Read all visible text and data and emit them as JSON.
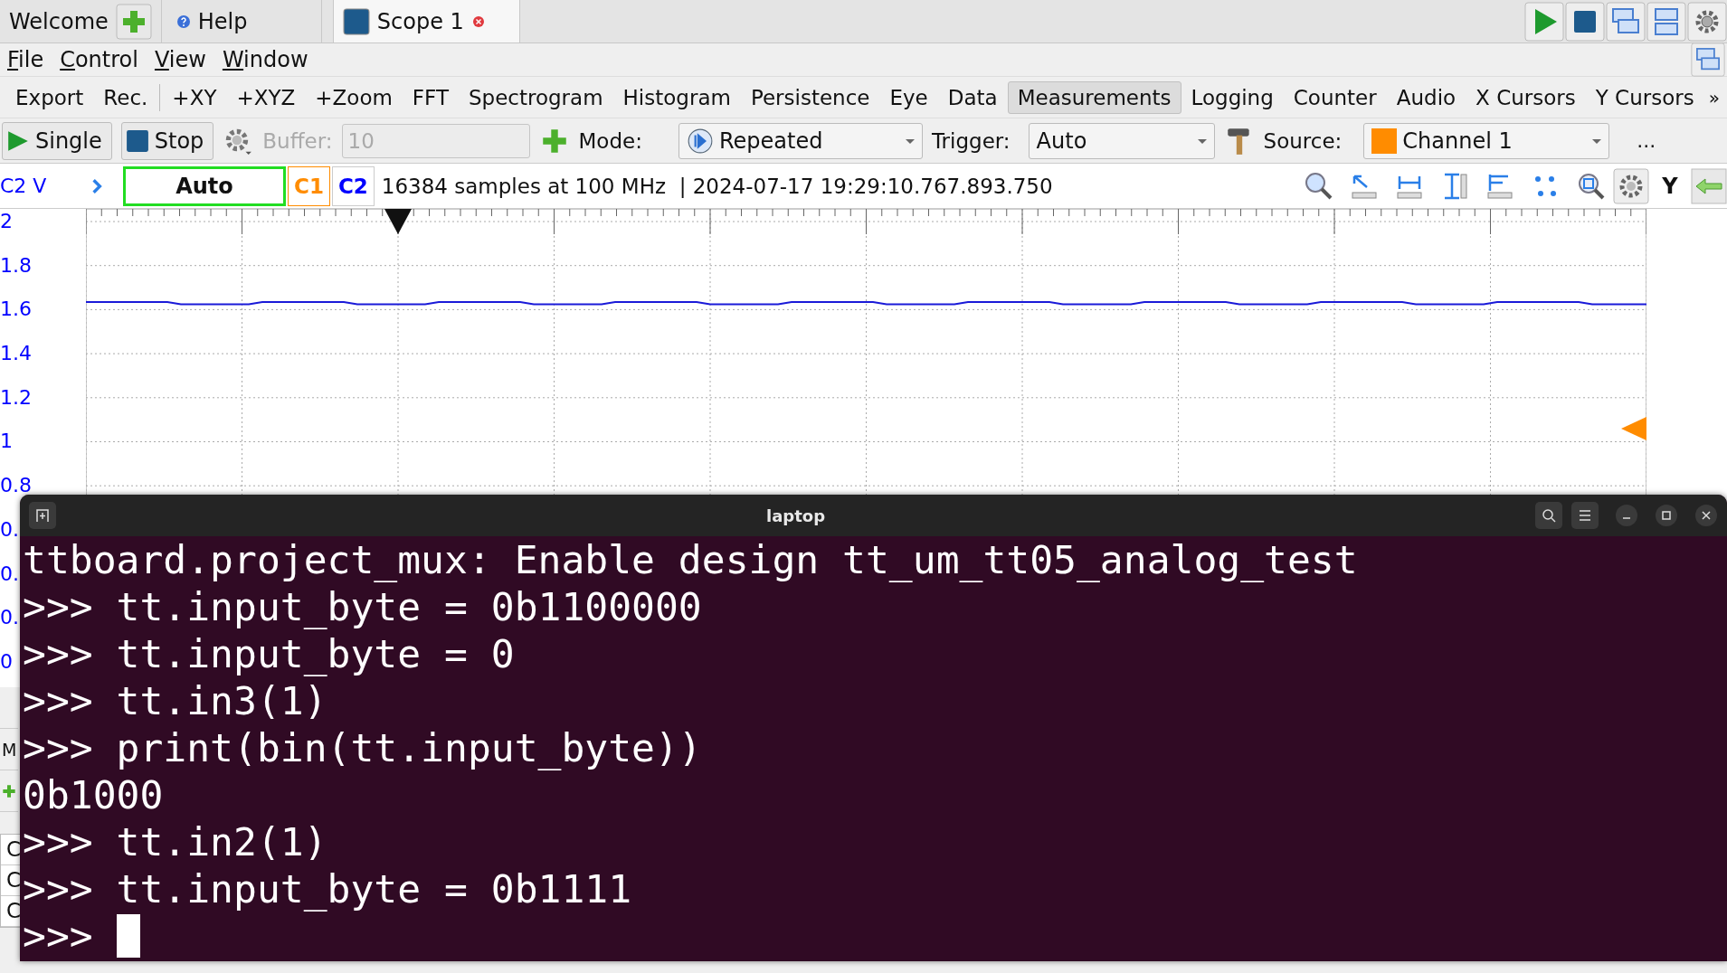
{
  "tabs": [
    {
      "label": "Welcome",
      "selected": false,
      "kind": "add"
    },
    {
      "label": "Help",
      "selected": false,
      "kind": "help"
    },
    {
      "label": "Scope 1",
      "selected": true,
      "kind": "scope"
    }
  ],
  "menu": [
    "File",
    "Control",
    "View",
    "Window"
  ],
  "views": [
    {
      "label": "Export",
      "selected": false
    },
    {
      "label": "Rec.",
      "selected": false
    },
    {
      "label": "+XY",
      "selected": false
    },
    {
      "label": "+XYZ",
      "selected": false
    },
    {
      "label": "+Zoom",
      "selected": false
    },
    {
      "label": "FFT",
      "selected": false
    },
    {
      "label": "Spectrogram",
      "selected": false
    },
    {
      "label": "Histogram",
      "selected": false
    },
    {
      "label": "Persistence",
      "selected": false
    },
    {
      "label": "Eye",
      "selected": false
    },
    {
      "label": "Data",
      "selected": false
    },
    {
      "label": "Measurements",
      "selected": true
    },
    {
      "label": "Logging",
      "selected": false
    },
    {
      "label": "Counter",
      "selected": false
    },
    {
      "label": "Audio",
      "selected": false
    },
    {
      "label": "X Cursors",
      "selected": false
    },
    {
      "label": "Y Cursors",
      "selected": false
    }
  ],
  "views_more": "»",
  "controls": {
    "single": "Single",
    "stop": "Stop",
    "buffer_label": "Buffer:",
    "buffer_value": "10",
    "buffer_disabled": true,
    "mode_label": "Mode:",
    "mode": "Repeated",
    "trigger_label": "Trigger:",
    "trigger": "Auto",
    "source_label": "Source:",
    "source": "Channel 1",
    "more": "..."
  },
  "info": {
    "axis": "C2 V",
    "trigger_state": "Auto",
    "channels": [
      {
        "label": "C1",
        "color": "#ff8c00"
      },
      {
        "label": "C2",
        "color": "#0000ff"
      }
    ],
    "status": "16384 samples at 100 MHz  | 2024-07-17 19:29:10.767.893.750",
    "y_button": "Y"
  },
  "y_ticks": [
    "2",
    "1.8",
    "1.6",
    "1.4",
    "1.2",
    "1",
    "0.8",
    "0.",
    "0.",
    "0.",
    "0"
  ],
  "left_partial": [
    "M",
    "C",
    "C",
    "C"
  ],
  "terminal": {
    "title": "laptop",
    "lines": [
      "ttboard.project_mux: Enable design tt_um_tt05_analog_test",
      ">>> tt.input_byte = 0b1100000",
      ">>> tt.input_byte = 0",
      ">>> tt.in3(1)",
      ">>> print(bin(tt.input_byte))",
      "0b1000",
      ">>> tt.in2(1)",
      ">>> tt.input_byte = 0b1111"
    ],
    "prompt": ">>> "
  }
}
